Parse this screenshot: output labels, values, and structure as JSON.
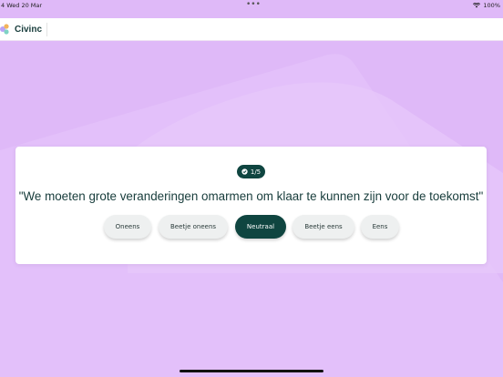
{
  "status_bar": {
    "time": "4  Wed 20 Mar",
    "dots": "•••",
    "battery": "100%"
  },
  "app": {
    "name": "Civinc"
  },
  "quiz": {
    "progress": "1/5",
    "statement": "\"We moeten grote veranderingen omarmen om klaar te kunnen zijn voor de toekomst\"",
    "answers": [
      {
        "label": "Oneens",
        "selected": false
      },
      {
        "label": "Beetje oneens",
        "selected": false
      },
      {
        "label": "Neutraal",
        "selected": true
      },
      {
        "label": "Beetje eens",
        "selected": false
      },
      {
        "label": "Eens",
        "selected": false
      }
    ]
  },
  "colors": {
    "background": "#DFB9F8",
    "accent": "#0F4540",
    "card": "#FFFFFF"
  }
}
